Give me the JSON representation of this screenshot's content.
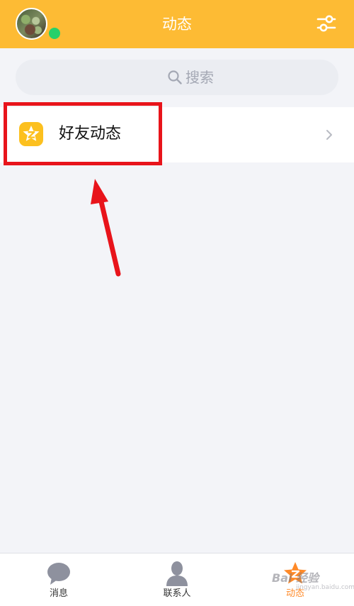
{
  "header": {
    "title": "动态",
    "status_color": "#28d06a",
    "accent_color": "#fdbb34",
    "settings_icon": "sliders-icon"
  },
  "search": {
    "placeholder": "搜索",
    "icon": "search-icon"
  },
  "list": {
    "items": [
      {
        "label": "好友动态",
        "icon": "qzone-star-icon"
      }
    ]
  },
  "annotation": {
    "box_color": "#e8141b"
  },
  "tabbar": {
    "items": [
      {
        "label": "消息",
        "icon": "chat-bubble-icon",
        "active": false
      },
      {
        "label": "联系人",
        "icon": "person-icon",
        "active": false
      },
      {
        "label": "动态",
        "icon": "star-icon",
        "active": true
      }
    ],
    "active_color": "#ff8a28"
  },
  "watermark": {
    "text": "Bai 经验",
    "sub": "jingyan.baidu.com"
  }
}
